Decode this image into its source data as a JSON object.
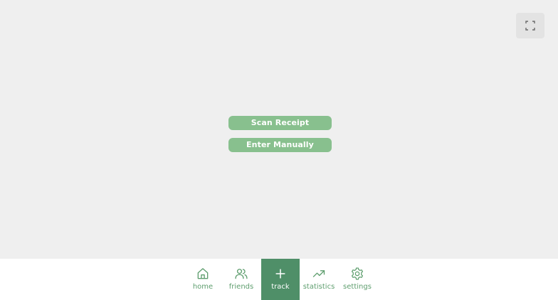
{
  "actions": {
    "scan_receipt": "Scan Receipt",
    "enter_manually": "Enter Manually"
  },
  "fullscreen": {
    "icon": "expand-icon"
  },
  "nav": {
    "items": [
      {
        "label": "home",
        "icon": "home-icon"
      },
      {
        "label": "friends",
        "icon": "users-icon"
      },
      {
        "label": "track",
        "icon": "plus-icon",
        "active": true
      },
      {
        "label": "statistics",
        "icon": "trending-up-icon"
      },
      {
        "label": "settings",
        "icon": "gear-icon"
      }
    ]
  },
  "colors": {
    "accent": "#4f8f68",
    "button": "#88c08e",
    "nav_icon": "#5e9e6e",
    "background": "#efefef"
  }
}
